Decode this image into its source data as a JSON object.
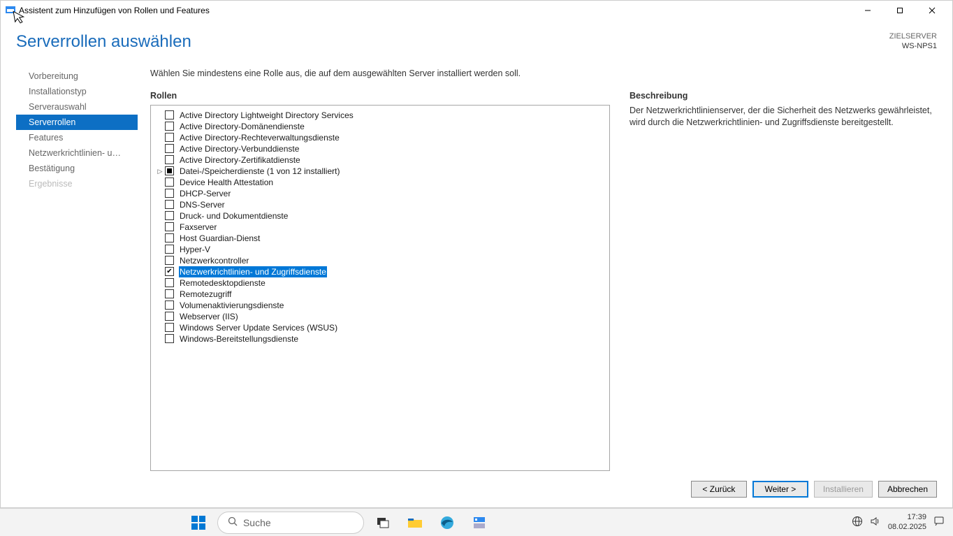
{
  "titlebar": {
    "title": "Assistent zum Hinzufügen von Rollen und Features"
  },
  "page": {
    "title": "Serverrollen auswählen"
  },
  "target": {
    "label": "ZIELSERVER",
    "name": "WS-NPS1"
  },
  "sidebar": {
    "items": [
      {
        "label": "Vorbereitung",
        "state": "normal"
      },
      {
        "label": "Installationstyp",
        "state": "normal"
      },
      {
        "label": "Serverauswahl",
        "state": "normal"
      },
      {
        "label": "Serverrollen",
        "state": "active"
      },
      {
        "label": "Features",
        "state": "normal"
      },
      {
        "label": "Netzwerkrichtlinien- und...",
        "state": "normal"
      },
      {
        "label": "Bestätigung",
        "state": "normal"
      },
      {
        "label": "Ergebnisse",
        "state": "disabled"
      }
    ]
  },
  "instruction": "Wählen Sie mindestens eine Rolle aus, die auf dem ausgewählten Server installiert werden soll.",
  "roles": {
    "heading": "Rollen",
    "items": [
      {
        "label": "Active Directory Lightweight Directory Services",
        "checked": false,
        "indeterminate": false,
        "expandable": false,
        "selected": false
      },
      {
        "label": "Active Directory-Domänendienste",
        "checked": false,
        "indeterminate": false,
        "expandable": false,
        "selected": false
      },
      {
        "label": "Active Directory-Rechteverwaltungsdienste",
        "checked": false,
        "indeterminate": false,
        "expandable": false,
        "selected": false
      },
      {
        "label": "Active Directory-Verbunddienste",
        "checked": false,
        "indeterminate": false,
        "expandable": false,
        "selected": false
      },
      {
        "label": "Active Directory-Zertifikatdienste",
        "checked": false,
        "indeterminate": false,
        "expandable": false,
        "selected": false
      },
      {
        "label": "Datei-/Speicherdienste (1 von 12 installiert)",
        "checked": false,
        "indeterminate": true,
        "expandable": true,
        "selected": false
      },
      {
        "label": "Device Health Attestation",
        "checked": false,
        "indeterminate": false,
        "expandable": false,
        "selected": false
      },
      {
        "label": "DHCP-Server",
        "checked": false,
        "indeterminate": false,
        "expandable": false,
        "selected": false
      },
      {
        "label": "DNS-Server",
        "checked": false,
        "indeterminate": false,
        "expandable": false,
        "selected": false
      },
      {
        "label": "Druck- und Dokumentdienste",
        "checked": false,
        "indeterminate": false,
        "expandable": false,
        "selected": false
      },
      {
        "label": "Faxserver",
        "checked": false,
        "indeterminate": false,
        "expandable": false,
        "selected": false
      },
      {
        "label": "Host Guardian-Dienst",
        "checked": false,
        "indeterminate": false,
        "expandable": false,
        "selected": false
      },
      {
        "label": "Hyper-V",
        "checked": false,
        "indeterminate": false,
        "expandable": false,
        "selected": false
      },
      {
        "label": "Netzwerkcontroller",
        "checked": false,
        "indeterminate": false,
        "expandable": false,
        "selected": false
      },
      {
        "label": "Netzwerkrichtlinien- und Zugriffsdienste",
        "checked": true,
        "indeterminate": false,
        "expandable": false,
        "selected": true
      },
      {
        "label": "Remotedesktopdienste",
        "checked": false,
        "indeterminate": false,
        "expandable": false,
        "selected": false
      },
      {
        "label": "Remotezugriff",
        "checked": false,
        "indeterminate": false,
        "expandable": false,
        "selected": false
      },
      {
        "label": "Volumenaktivierungsdienste",
        "checked": false,
        "indeterminate": false,
        "expandable": false,
        "selected": false
      },
      {
        "label": "Webserver (IIS)",
        "checked": false,
        "indeterminate": false,
        "expandable": false,
        "selected": false
      },
      {
        "label": "Windows Server Update Services (WSUS)",
        "checked": false,
        "indeterminate": false,
        "expandable": false,
        "selected": false
      },
      {
        "label": "Windows-Bereitstellungsdienste",
        "checked": false,
        "indeterminate": false,
        "expandable": false,
        "selected": false
      }
    ]
  },
  "description": {
    "heading": "Beschreibung",
    "text": "Der Netzwerkrichtlinienserver, der die Sicherheit des Netzwerks gewährleistet, wird durch die Netzwerkrichtlinien- und Zugriffsdienste bereitgestellt."
  },
  "footer": {
    "back": "< Zurück",
    "next": "Weiter >",
    "install": "Installieren",
    "cancel": "Abbrechen"
  },
  "taskbar": {
    "search_placeholder": "Suche",
    "time": "17:39",
    "date": "08.02.2025"
  }
}
